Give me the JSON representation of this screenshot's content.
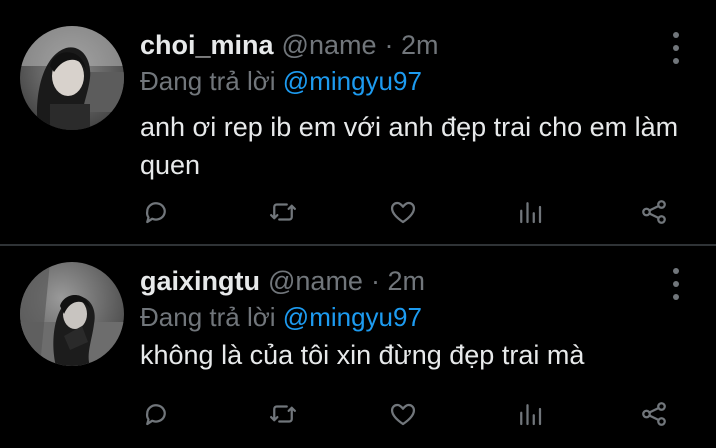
{
  "tweets": [
    {
      "display_name": "choi_mina",
      "handle": "@name",
      "time": "· 2m",
      "reply_prefix": "Đang trả lời",
      "reply_to": "@mingyu97",
      "text": "anh ơi rep ib em với anh đẹp trai cho em làm quen",
      "avatar": "profile-photo-girl-dark"
    },
    {
      "display_name": "gaixingtu",
      "handle": "@name",
      "time": "· 2m",
      "reply_prefix": "Đang trả lời",
      "reply_to": "@mingyu97",
      "text": "không là của tôi xin đừng đẹp trai mà",
      "avatar": "profile-photo-grayscale"
    }
  ],
  "icons": {
    "reply": "speech-bubble-icon",
    "retweet": "retweet-icon",
    "like": "heart-icon",
    "stats": "bar-chart-icon",
    "share": "share-icon",
    "more": "vertical-ellipsis-icon"
  },
  "colors": {
    "background": "#000000",
    "text": "#e7e9ea",
    "muted": "#71767b",
    "accent": "#1d9bf0",
    "divider": "#2f3336"
  }
}
